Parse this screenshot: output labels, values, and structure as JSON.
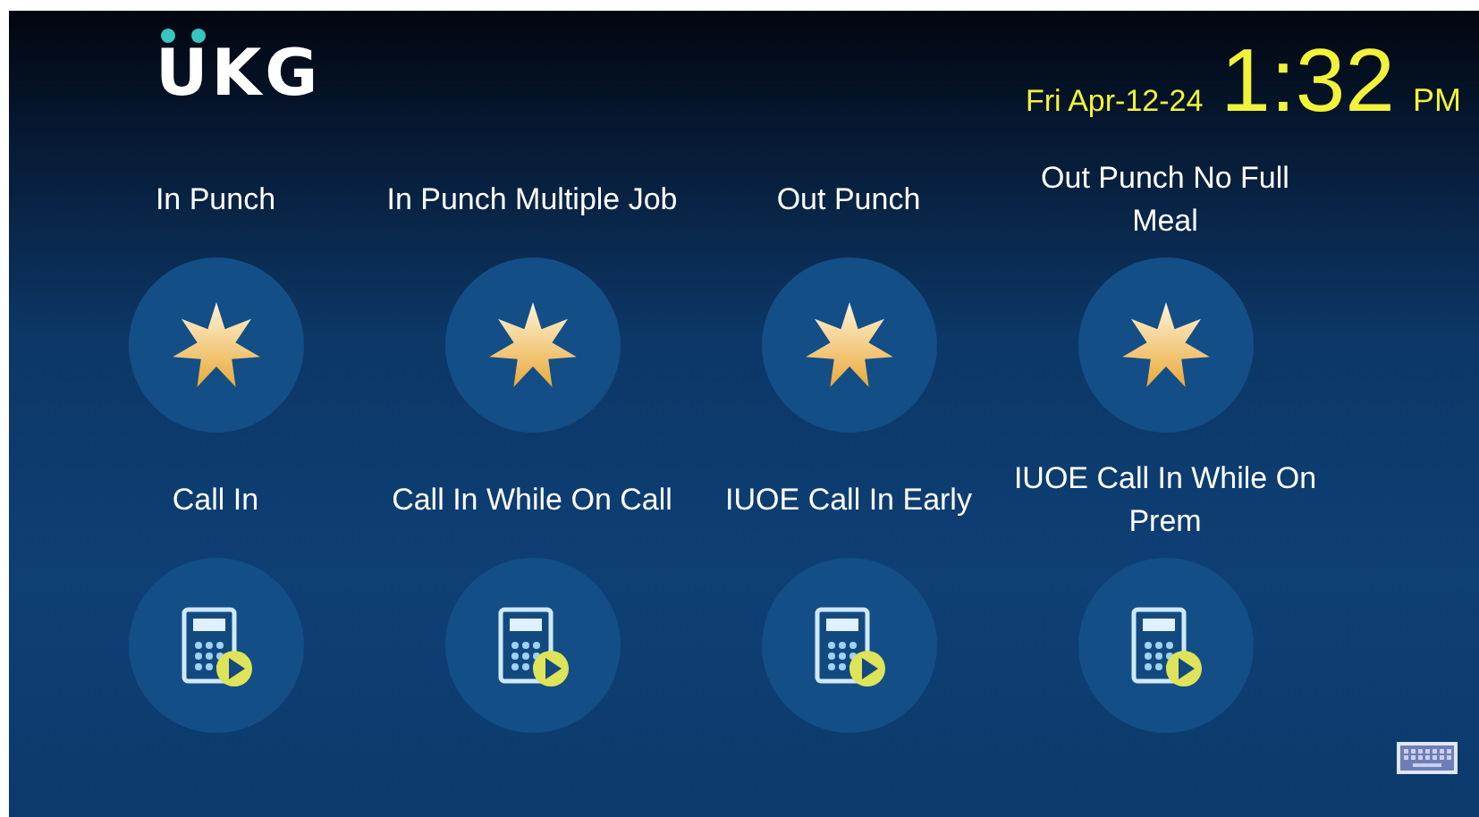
{
  "header": {
    "logo": "UKG",
    "date": "Fri Apr-12-24",
    "time": "1:32",
    "meridiem": "PM"
  },
  "actions": [
    {
      "label": "In Punch",
      "kind": "punch"
    },
    {
      "label": "In Punch Multiple Job",
      "kind": "punch"
    },
    {
      "label": "Out Punch",
      "kind": "punch"
    },
    {
      "label": "Out Punch No Full Meal",
      "kind": "punch"
    },
    {
      "label": "Call In",
      "kind": "call"
    },
    {
      "label": "Call In While On Call",
      "kind": "call"
    },
    {
      "label": "IUOE Call In Early",
      "kind": "call"
    },
    {
      "label": "IUOE Call In While On Prem",
      "kind": "call"
    }
  ]
}
